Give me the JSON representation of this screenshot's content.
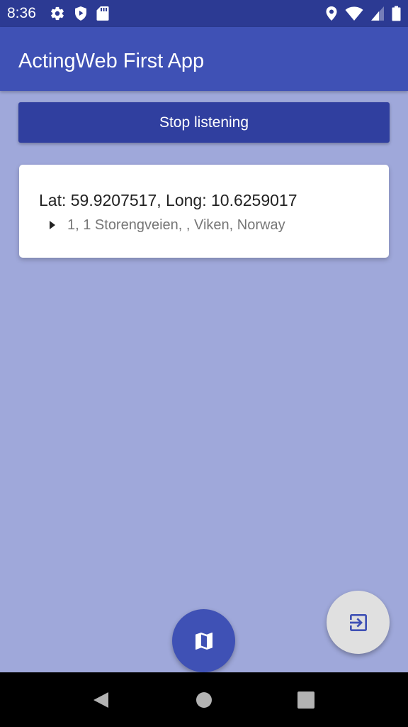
{
  "status_bar": {
    "time": "8:36",
    "icons_left": [
      "settings-icon",
      "play-protect-icon",
      "sd-card-icon"
    ],
    "icons_right": [
      "location-icon",
      "wifi-icon",
      "signal-icon",
      "battery-icon"
    ]
  },
  "app_bar": {
    "title": "ActingWeb First App"
  },
  "controls": {
    "stop_button_label": "Stop listening"
  },
  "location": {
    "coordinates": "Lat: 59.9207517, Long: 10.6259017",
    "address": "1, 1 Storengveien, , Viken, Norway"
  },
  "fabs": {
    "exit_icon": "exit-icon",
    "map_icon": "map-icon"
  },
  "colors": {
    "status_bar": "#2c3a93",
    "app_bar": "#3f51b5",
    "primary_dark": "#303f9f",
    "background": "#9fa8da",
    "exit_fab": "#e0e0e0",
    "exit_icon": "#3f51b5"
  },
  "nav_bar": {
    "icons": [
      "back-icon",
      "home-icon",
      "recents-icon"
    ]
  }
}
